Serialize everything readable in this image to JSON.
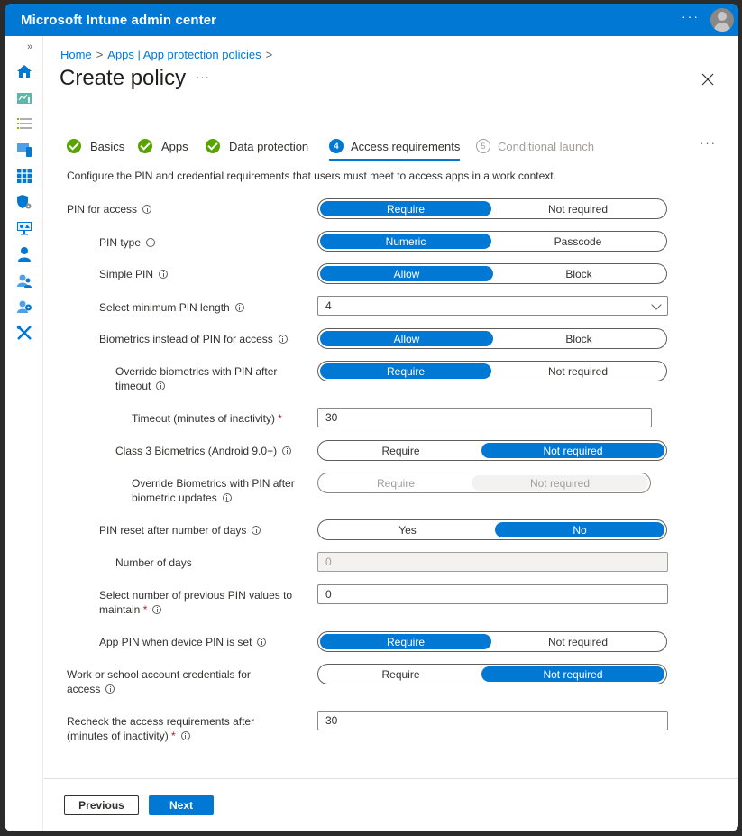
{
  "app": {
    "title": "Microsoft Intune admin center",
    "more_label": "···"
  },
  "nav": {
    "expand_label": "»",
    "icons": [
      "home-icon",
      "dashboard-icon",
      "all-services-icon",
      "devices-icon",
      "apps-icon",
      "endpoint-security-icon",
      "reports-icon",
      "users-icon",
      "groups-icon",
      "tenant-admin-icon",
      "troubleshooting-icon"
    ]
  },
  "breadcrumb": {
    "items": [
      "Home",
      "Apps | App protection policies"
    ],
    "separator": ">"
  },
  "page": {
    "title": "Create policy",
    "more_label": "···"
  },
  "wizard": {
    "steps": [
      {
        "label": "Basics",
        "status": "complete"
      },
      {
        "label": "Apps",
        "status": "complete"
      },
      {
        "label": "Data protection",
        "status": "complete"
      },
      {
        "label": "Access requirements",
        "status": "active",
        "number": "4"
      },
      {
        "label": "Conditional launch",
        "status": "future",
        "number": "5"
      }
    ],
    "more_label": "···"
  },
  "description": "Configure the PIN and credential requirements that users must meet to access apps in a work context.",
  "settings": {
    "pin_for_access": {
      "label": "PIN for access",
      "options": [
        "Require",
        "Not required"
      ],
      "selected": "Require"
    },
    "pin_type": {
      "label": "PIN type",
      "options": [
        "Numeric",
        "Passcode"
      ],
      "selected": "Numeric"
    },
    "simple_pin": {
      "label": "Simple PIN",
      "options": [
        "Allow",
        "Block"
      ],
      "selected": "Allow"
    },
    "min_pin_length": {
      "label": "Select minimum PIN length",
      "value": "4"
    },
    "biometrics": {
      "label": "Biometrics instead of PIN for access",
      "options": [
        "Allow",
        "Block"
      ],
      "selected": "Allow"
    },
    "override_biometrics": {
      "label_line1": "Override biometrics with PIN after",
      "label_line2": "timeout",
      "options": [
        "Require",
        "Not required"
      ],
      "selected": "Require"
    },
    "timeout": {
      "label": "Timeout (minutes of inactivity)",
      "required_mark": "*",
      "value": "30"
    },
    "class3_biometrics": {
      "label": "Class 3 Biometrics (Android 9.0+)",
      "options": [
        "Require",
        "Not required"
      ],
      "selected": "Not required"
    },
    "override_biometric_updates": {
      "label_line1": "Override Biometrics with PIN after",
      "label_line2": "biometric updates",
      "options": [
        "Require",
        "Not required"
      ],
      "selected": "Not required",
      "disabled": true
    },
    "pin_reset": {
      "label": "PIN reset after number of days",
      "options": [
        "Yes",
        "No"
      ],
      "selected": "No"
    },
    "number_of_days": {
      "label": "Number of days",
      "value": "0",
      "disabled": true
    },
    "previous_pin_values": {
      "label_line1": "Select number of previous PIN values to",
      "label_line2": "maintain",
      "required_mark": "*",
      "value": "0"
    },
    "app_pin_device_pin": {
      "label": "App PIN when device PIN is set",
      "options": [
        "Require",
        "Not required"
      ],
      "selected": "Require"
    },
    "work_credentials": {
      "label_line1": "Work or school account credentials for",
      "label_line2": "access",
      "options": [
        "Require",
        "Not required"
      ],
      "selected": "Not required"
    },
    "recheck": {
      "label_line1": "Recheck the access requirements after",
      "label_line2": "(minutes of inactivity)",
      "required_mark": "*",
      "value": "30"
    }
  },
  "footer": {
    "previous_label": "Previous",
    "next_label": "Next"
  },
  "colors": {
    "accent": "#0078d4",
    "success": "#57a300",
    "required": "#a4262c"
  }
}
